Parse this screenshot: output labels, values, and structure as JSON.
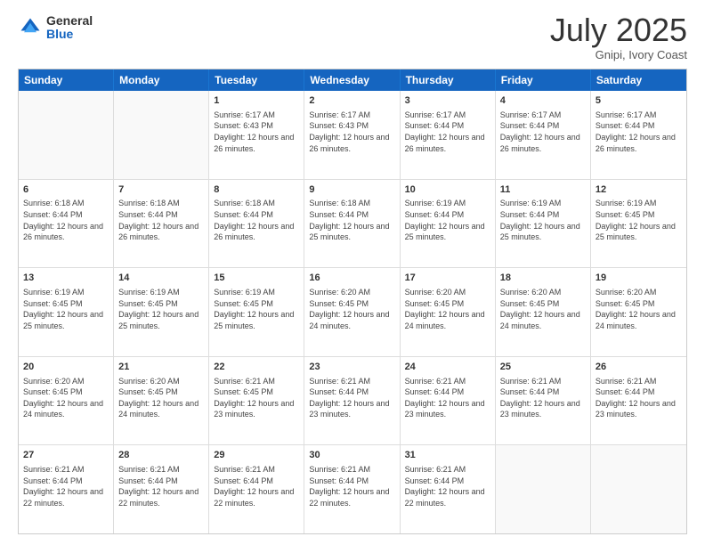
{
  "logo": {
    "general": "General",
    "blue": "Blue"
  },
  "header": {
    "month": "July 2025",
    "location": "Gnipi, Ivory Coast"
  },
  "days": [
    "Sunday",
    "Monday",
    "Tuesday",
    "Wednesday",
    "Thursday",
    "Friday",
    "Saturday"
  ],
  "weeks": [
    [
      {
        "num": "",
        "info": ""
      },
      {
        "num": "",
        "info": ""
      },
      {
        "num": "1",
        "info": "Sunrise: 6:17 AM\nSunset: 6:43 PM\nDaylight: 12 hours and 26 minutes."
      },
      {
        "num": "2",
        "info": "Sunrise: 6:17 AM\nSunset: 6:43 PM\nDaylight: 12 hours and 26 minutes."
      },
      {
        "num": "3",
        "info": "Sunrise: 6:17 AM\nSunset: 6:44 PM\nDaylight: 12 hours and 26 minutes."
      },
      {
        "num": "4",
        "info": "Sunrise: 6:17 AM\nSunset: 6:44 PM\nDaylight: 12 hours and 26 minutes."
      },
      {
        "num": "5",
        "info": "Sunrise: 6:17 AM\nSunset: 6:44 PM\nDaylight: 12 hours and 26 minutes."
      }
    ],
    [
      {
        "num": "6",
        "info": "Sunrise: 6:18 AM\nSunset: 6:44 PM\nDaylight: 12 hours and 26 minutes."
      },
      {
        "num": "7",
        "info": "Sunrise: 6:18 AM\nSunset: 6:44 PM\nDaylight: 12 hours and 26 minutes."
      },
      {
        "num": "8",
        "info": "Sunrise: 6:18 AM\nSunset: 6:44 PM\nDaylight: 12 hours and 26 minutes."
      },
      {
        "num": "9",
        "info": "Sunrise: 6:18 AM\nSunset: 6:44 PM\nDaylight: 12 hours and 25 minutes."
      },
      {
        "num": "10",
        "info": "Sunrise: 6:19 AM\nSunset: 6:44 PM\nDaylight: 12 hours and 25 minutes."
      },
      {
        "num": "11",
        "info": "Sunrise: 6:19 AM\nSunset: 6:44 PM\nDaylight: 12 hours and 25 minutes."
      },
      {
        "num": "12",
        "info": "Sunrise: 6:19 AM\nSunset: 6:45 PM\nDaylight: 12 hours and 25 minutes."
      }
    ],
    [
      {
        "num": "13",
        "info": "Sunrise: 6:19 AM\nSunset: 6:45 PM\nDaylight: 12 hours and 25 minutes."
      },
      {
        "num": "14",
        "info": "Sunrise: 6:19 AM\nSunset: 6:45 PM\nDaylight: 12 hours and 25 minutes."
      },
      {
        "num": "15",
        "info": "Sunrise: 6:19 AM\nSunset: 6:45 PM\nDaylight: 12 hours and 25 minutes."
      },
      {
        "num": "16",
        "info": "Sunrise: 6:20 AM\nSunset: 6:45 PM\nDaylight: 12 hours and 24 minutes."
      },
      {
        "num": "17",
        "info": "Sunrise: 6:20 AM\nSunset: 6:45 PM\nDaylight: 12 hours and 24 minutes."
      },
      {
        "num": "18",
        "info": "Sunrise: 6:20 AM\nSunset: 6:45 PM\nDaylight: 12 hours and 24 minutes."
      },
      {
        "num": "19",
        "info": "Sunrise: 6:20 AM\nSunset: 6:45 PM\nDaylight: 12 hours and 24 minutes."
      }
    ],
    [
      {
        "num": "20",
        "info": "Sunrise: 6:20 AM\nSunset: 6:45 PM\nDaylight: 12 hours and 24 minutes."
      },
      {
        "num": "21",
        "info": "Sunrise: 6:20 AM\nSunset: 6:45 PM\nDaylight: 12 hours and 24 minutes."
      },
      {
        "num": "22",
        "info": "Sunrise: 6:21 AM\nSunset: 6:45 PM\nDaylight: 12 hours and 23 minutes."
      },
      {
        "num": "23",
        "info": "Sunrise: 6:21 AM\nSunset: 6:44 PM\nDaylight: 12 hours and 23 minutes."
      },
      {
        "num": "24",
        "info": "Sunrise: 6:21 AM\nSunset: 6:44 PM\nDaylight: 12 hours and 23 minutes."
      },
      {
        "num": "25",
        "info": "Sunrise: 6:21 AM\nSunset: 6:44 PM\nDaylight: 12 hours and 23 minutes."
      },
      {
        "num": "26",
        "info": "Sunrise: 6:21 AM\nSunset: 6:44 PM\nDaylight: 12 hours and 23 minutes."
      }
    ],
    [
      {
        "num": "27",
        "info": "Sunrise: 6:21 AM\nSunset: 6:44 PM\nDaylight: 12 hours and 22 minutes."
      },
      {
        "num": "28",
        "info": "Sunrise: 6:21 AM\nSunset: 6:44 PM\nDaylight: 12 hours and 22 minutes."
      },
      {
        "num": "29",
        "info": "Sunrise: 6:21 AM\nSunset: 6:44 PM\nDaylight: 12 hours and 22 minutes."
      },
      {
        "num": "30",
        "info": "Sunrise: 6:21 AM\nSunset: 6:44 PM\nDaylight: 12 hours and 22 minutes."
      },
      {
        "num": "31",
        "info": "Sunrise: 6:21 AM\nSunset: 6:44 PM\nDaylight: 12 hours and 22 minutes."
      },
      {
        "num": "",
        "info": ""
      },
      {
        "num": "",
        "info": ""
      }
    ]
  ]
}
